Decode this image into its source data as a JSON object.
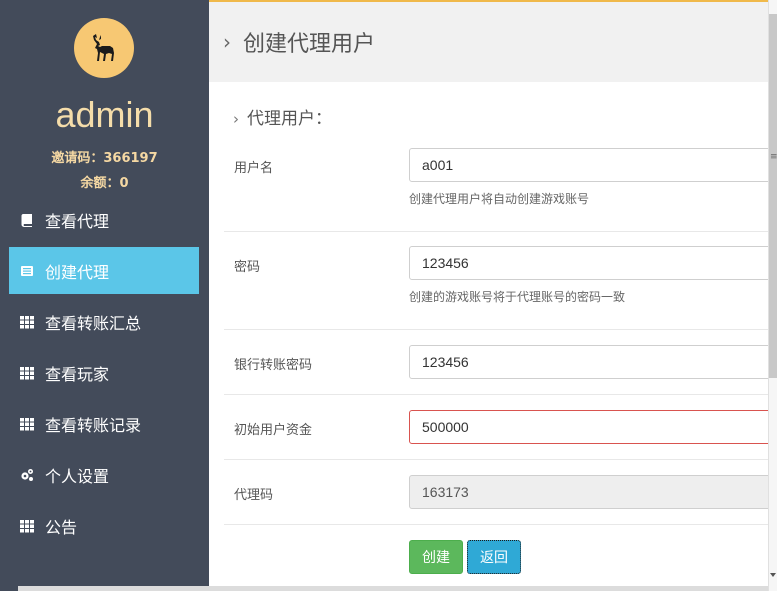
{
  "sidebar": {
    "username": "admin",
    "invite_code": "邀请码：366197",
    "balance": "余额：0",
    "items": [
      {
        "label": "查看代理",
        "icon": "book-icon"
      },
      {
        "label": "创建代理",
        "icon": "list-icon"
      },
      {
        "label": "查看转账汇总",
        "icon": "grid-icon"
      },
      {
        "label": "查看玩家",
        "icon": "grid-icon"
      },
      {
        "label": "查看转账记录",
        "icon": "grid-icon"
      },
      {
        "label": "个人设置",
        "icon": "gears-icon"
      },
      {
        "label": "公告",
        "icon": "grid-icon"
      }
    ],
    "active_item": "创建代理"
  },
  "header": {
    "title": "创建代理用户"
  },
  "form": {
    "title": "代理用户：",
    "username": {
      "label": "用户名",
      "value": "a001",
      "hint": "创建代理用户将自动创建游戏账号"
    },
    "password": {
      "label": "密码",
      "value": "123456",
      "hint": "创建的游戏账号将于代理账号的密码一致"
    },
    "bank_password": {
      "label": "银行转账密码",
      "value": "123456"
    },
    "initial_funds": {
      "label": "初始用户资金",
      "value": "500000"
    },
    "agent_code": {
      "label": "代理码",
      "value": "163173"
    },
    "create_label": "创建",
    "back_label": "返回"
  },
  "colors": {
    "sidebar_bg": "#434b5a",
    "active_item": "#5bc6e8",
    "create_button": "#5cb85c",
    "back_button": "#2fa9d6",
    "error_border": "#d9534f",
    "accent_line": "#f0b94a"
  }
}
